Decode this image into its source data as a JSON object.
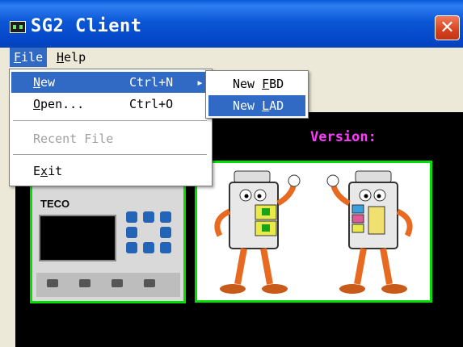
{
  "window": {
    "title": "SG2 Client",
    "close_glyph": "✕"
  },
  "menubar": {
    "file": {
      "mnemonic": "F",
      "rest": "ile"
    },
    "help": {
      "mnemonic": "H",
      "rest": "elp"
    }
  },
  "file_menu": {
    "new": {
      "mnemonic": "N",
      "rest": "ew",
      "shortcut": "Ctrl+N"
    },
    "open": {
      "mnemonic": "O",
      "rest": "pen...",
      "shortcut": "Ctrl+O"
    },
    "recent": {
      "label": "Recent File"
    },
    "exit": {
      "pre": "E",
      "mnemonic": "x",
      "rest": "it"
    }
  },
  "new_submenu": {
    "fbd": {
      "pre": "New ",
      "mnemonic": "F",
      "rest": "BD"
    },
    "lad": {
      "pre": "New ",
      "mnemonic": "L",
      "rest": "AD"
    }
  },
  "content": {
    "version_label": "Version:",
    "plc_brand": "TECO"
  },
  "colors": {
    "title_bar": "#0b57d6",
    "menu_highlight": "#316ac5",
    "version_text": "#ff3bff",
    "panel_border": "#00e000"
  }
}
